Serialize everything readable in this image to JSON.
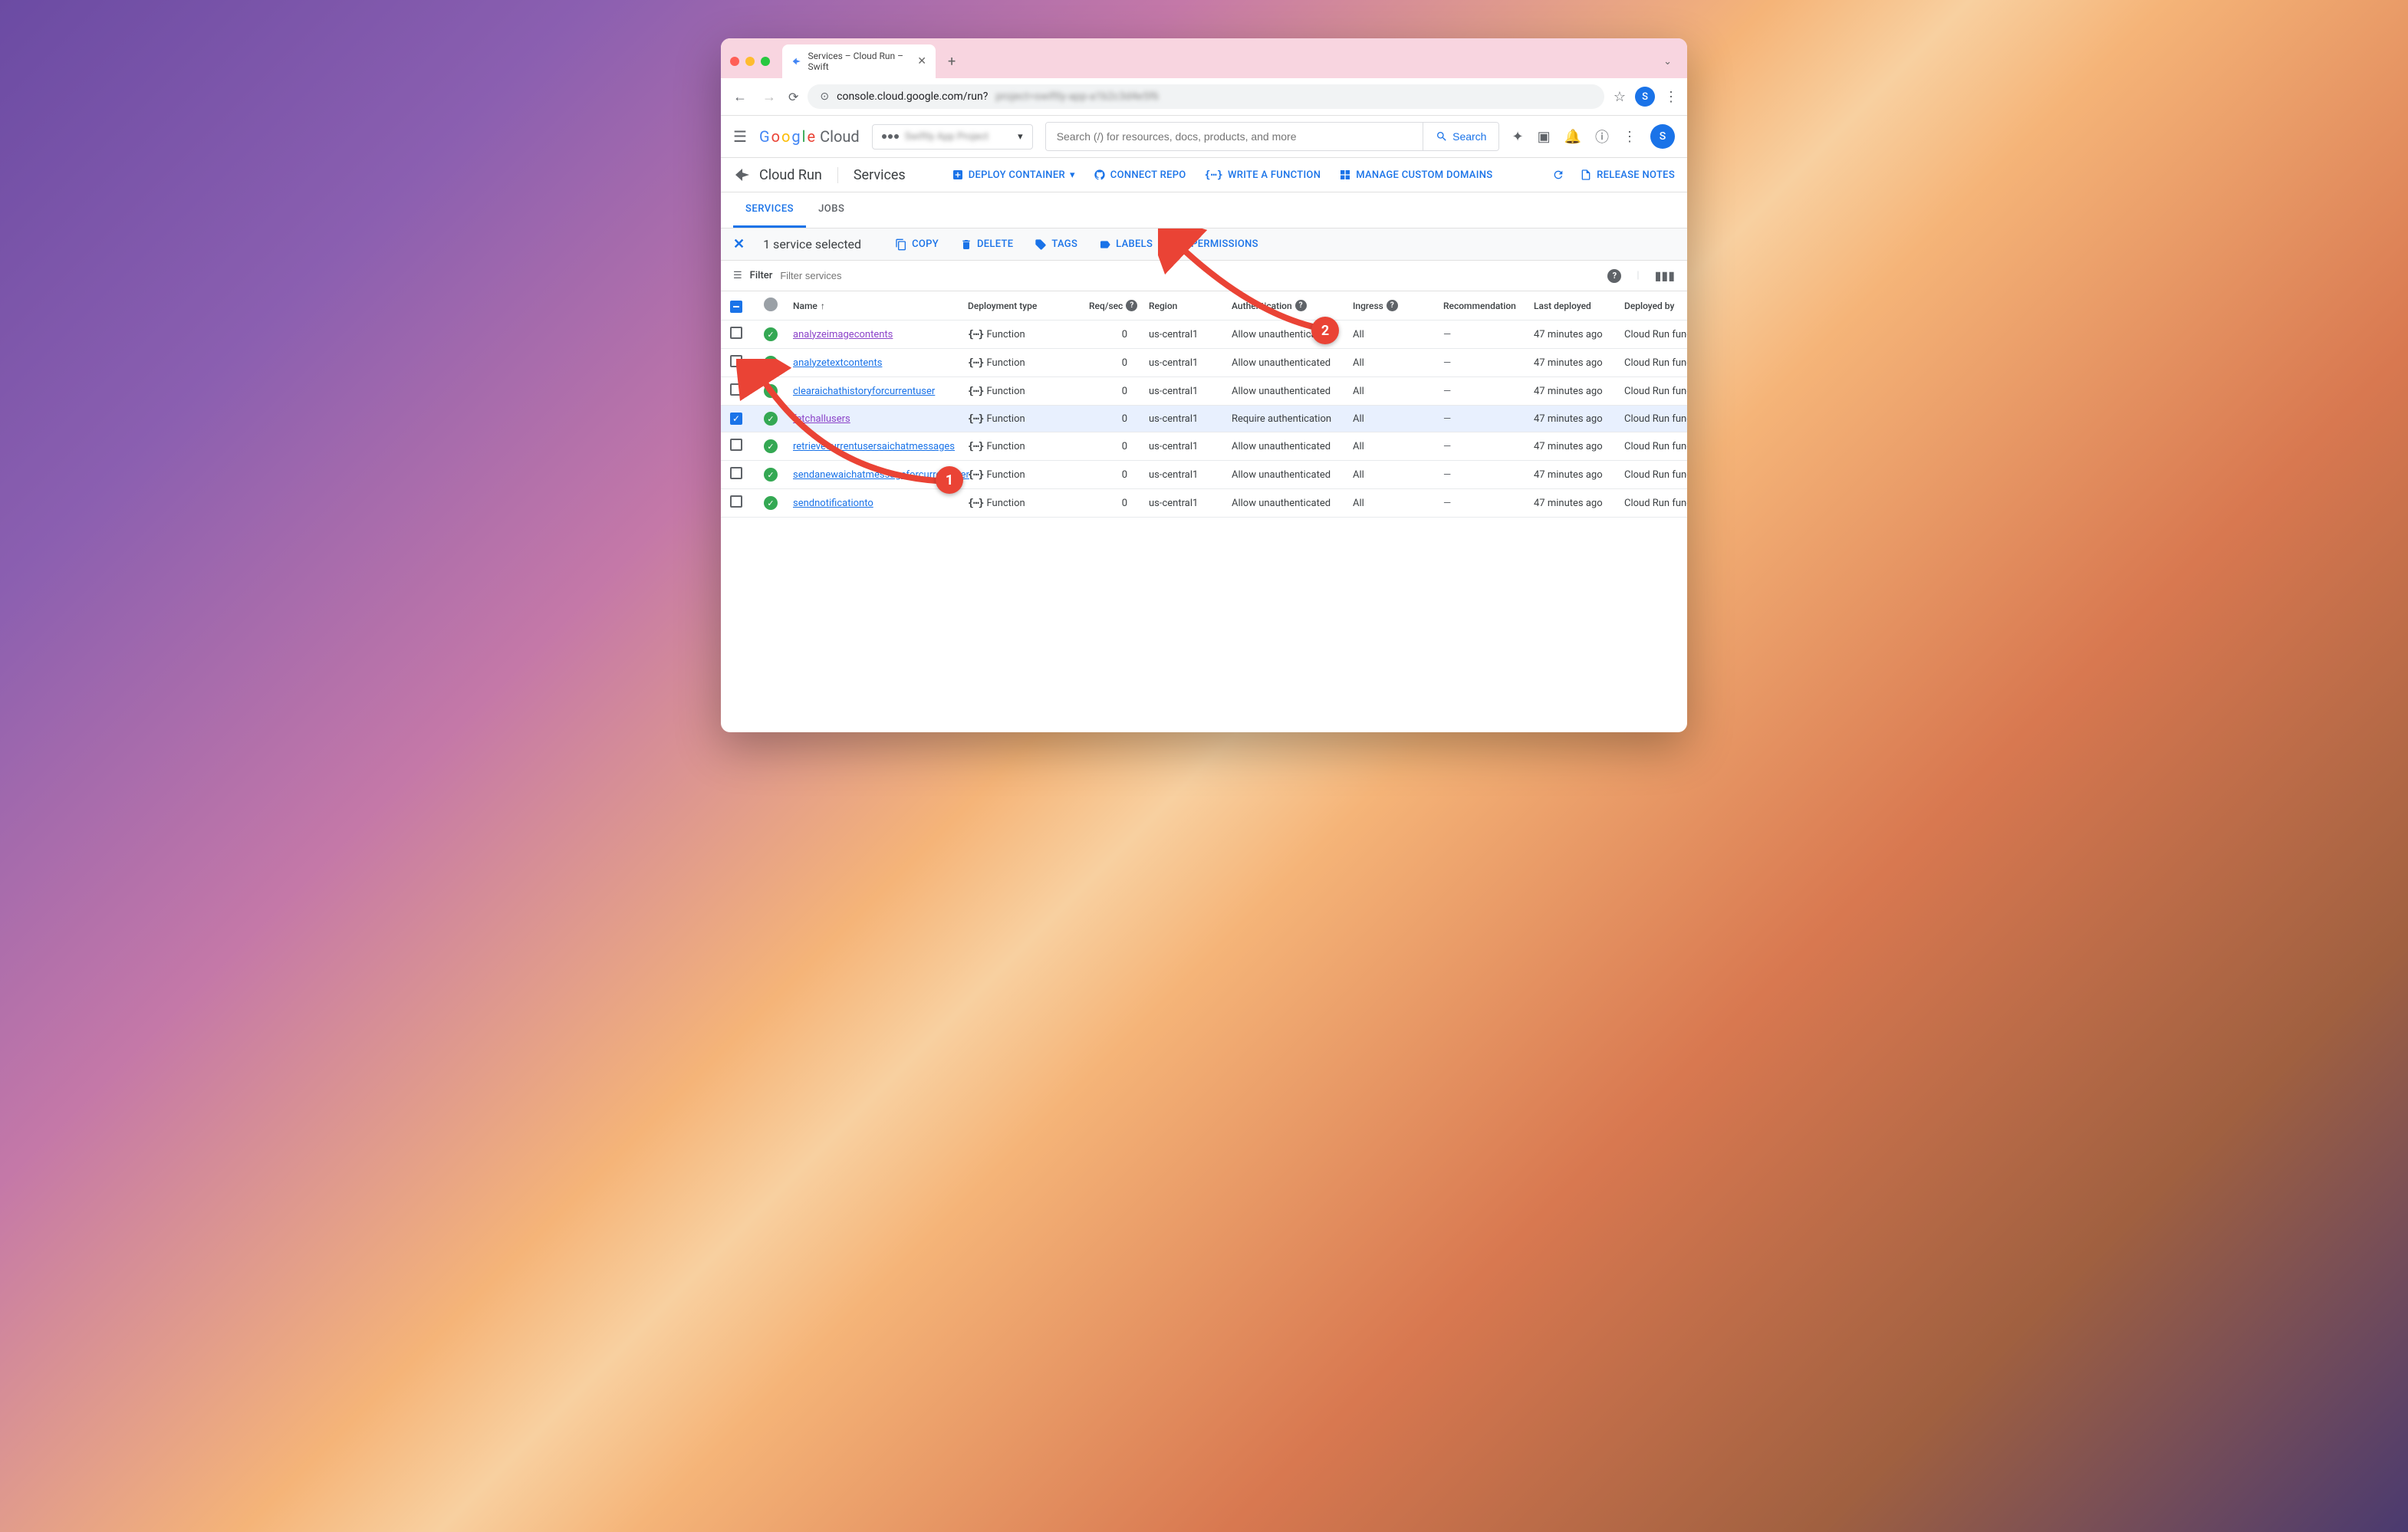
{
  "browser": {
    "tab_title": "Services – Cloud Run – Swift",
    "url_visible": "console.cloud.google.com/run?",
    "url_blurred": "project=swiftly-app-a1b2c3d4e5f6"
  },
  "header": {
    "logo_text": "Google Cloud",
    "project_name_blurred": "Swiftly App Project",
    "search_placeholder": "Search (/) for resources, docs, products, and more",
    "search_button": "Search",
    "avatar_letter": "S"
  },
  "service_bar": {
    "product": "Cloud Run",
    "section": "Services",
    "actions": {
      "deploy": "DEPLOY CONTAINER",
      "connect_repo": "CONNECT REPO",
      "write_function": "WRITE A FUNCTION",
      "manage_domains": "MANAGE CUSTOM DOMAINS",
      "release_notes": "RELEASE NOTES"
    }
  },
  "tabs": {
    "services": "SERVICES",
    "jobs": "JOBS"
  },
  "selection": {
    "text": "1 service selected",
    "copy": "COPY",
    "delete": "DELETE",
    "tags": "TAGS",
    "labels": "LABELS",
    "permissions": "PERMISSIONS"
  },
  "filter": {
    "label": "Filter",
    "placeholder": "Filter services"
  },
  "columns": {
    "name": "Name",
    "deployment_type": "Deployment type",
    "req_sec": "Req/sec",
    "region": "Region",
    "authentication": "Authentication",
    "ingress": "Ingress",
    "recommendation": "Recommendation",
    "last_deployed": "Last deployed",
    "deployed_by": "Deployed by"
  },
  "rows": [
    {
      "selected": false,
      "name": "analyzeimagecontents",
      "visited": true,
      "type": "Function",
      "req_sec": "0",
      "region": "us-central1",
      "auth": "Allow unauthenticated",
      "ingress": "All",
      "recommendation": "—",
      "last_deployed": "47 minutes ago",
      "deployed_by": "Cloud Run functions"
    },
    {
      "selected": false,
      "name": "analyzetextcontents",
      "visited": false,
      "type": "Function",
      "req_sec": "0",
      "region": "us-central1",
      "auth": "Allow unauthenticated",
      "ingress": "All",
      "recommendation": "—",
      "last_deployed": "47 minutes ago",
      "deployed_by": "Cloud Run functions"
    },
    {
      "selected": false,
      "name": "clearaichathistoryforcurrentuser",
      "visited": false,
      "type": "Function",
      "req_sec": "0",
      "region": "us-central1",
      "auth": "Allow unauthenticated",
      "ingress": "All",
      "recommendation": "—",
      "last_deployed": "47 minutes ago",
      "deployed_by": "Cloud Run functions"
    },
    {
      "selected": true,
      "name": "fetchallusers",
      "visited": true,
      "type": "Function",
      "req_sec": "0",
      "region": "us-central1",
      "auth": "Require authentication",
      "ingress": "All",
      "recommendation": "—",
      "last_deployed": "47 minutes ago",
      "deployed_by": "Cloud Run functions"
    },
    {
      "selected": false,
      "name": "retrievecurrentusersaichatmessages",
      "visited": false,
      "type": "Function",
      "req_sec": "0",
      "region": "us-central1",
      "auth": "Allow unauthenticated",
      "ingress": "All",
      "recommendation": "—",
      "last_deployed": "47 minutes ago",
      "deployed_by": "Cloud Run functions"
    },
    {
      "selected": false,
      "name": "sendanewaichatmessageforcurrentuser",
      "visited": false,
      "type": "Function",
      "req_sec": "0",
      "region": "us-central1",
      "auth": "Allow unauthenticated",
      "ingress": "All",
      "recommendation": "—",
      "last_deployed": "47 minutes ago",
      "deployed_by": "Cloud Run functions"
    },
    {
      "selected": false,
      "name": "sendnotificationto",
      "visited": false,
      "type": "Function",
      "req_sec": "0",
      "region": "us-central1",
      "auth": "Allow unauthenticated",
      "ingress": "All",
      "recommendation": "—",
      "last_deployed": "47 minutes ago",
      "deployed_by": "Cloud Run functions"
    }
  ],
  "annotations": {
    "badge1": "1",
    "badge2": "2"
  }
}
